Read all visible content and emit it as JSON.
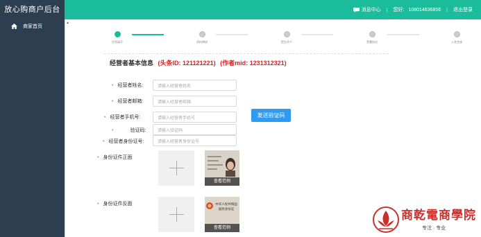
{
  "sidebar": {
    "brand": "放心购商户后台",
    "items": [
      {
        "label": "商家首页",
        "icon": "home-icon"
      }
    ]
  },
  "header": {
    "message_center": "消息中心",
    "greeting": "您好:",
    "user": "108014636856",
    "logout": "退出登录"
  },
  "steps": [
    {
      "label": "信息填写",
      "active": true
    },
    {
      "label": "资料审核",
      "active": false
    },
    {
      "label": "提交开户",
      "active": false
    },
    {
      "label": "签署协议",
      "active": false
    },
    {
      "label": "入驻完成",
      "active": false
    }
  ],
  "form": {
    "title": "经营者基本信息",
    "toutiao_id": "(头条ID: 121121221)",
    "author_mid": "(作者mid: 1231312321)",
    "fields": [
      {
        "label": "经营者姓名:",
        "placeholder": "请输入经营者姓名"
      },
      {
        "label": "经营者邮箱:",
        "placeholder": "请输入经营者邮箱"
      },
      {
        "label": "经营者手机号:",
        "placeholder": "请输入经营者手机号"
      },
      {
        "label": "验证码:",
        "placeholder": "请输入验证码"
      },
      {
        "label": "经营者身份证号:",
        "placeholder": "请输入经营者身份证号"
      }
    ],
    "send_code": "发送验证码",
    "id_front_label": "身份证件正面",
    "id_back_label": "身份证件反面",
    "view_sample": "查看范例",
    "id_back_sample_text": "中华人民共和国 居民身份证"
  },
  "watermark": {
    "name": "商乾電商學院",
    "slogan": "专注 · 专业"
  },
  "colors": {
    "sidebar": "#2c3e50",
    "header": "#1bbc9b",
    "accent_red": "#e02020",
    "button_blue": "#2f9bf0",
    "watermark": "#c9302c"
  }
}
